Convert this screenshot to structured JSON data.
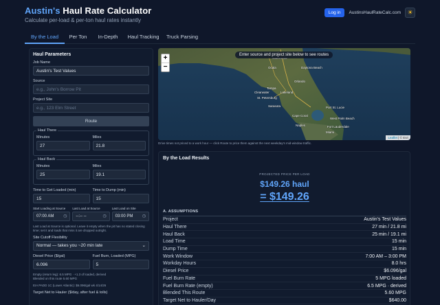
{
  "header": {
    "title_accent": "Austin's",
    "title_rest": " Haul Rate Calculator",
    "subtitle": "Calculate per-load & per-ton haul rates instantly",
    "login_label": "Log in",
    "site_link": "AustinsHaulRateCalc.com",
    "theme_icon": "sun-icon"
  },
  "tabs": [
    {
      "label": "By the Load",
      "active": true
    },
    {
      "label": "Per Ton"
    },
    {
      "label": "In-Depth"
    },
    {
      "label": "Haul Tracking"
    },
    {
      "label": "Truck Parsing"
    }
  ],
  "params": {
    "title": "Haul Parameters",
    "job_name_label": "Job Name",
    "job_name_value": "Austin's Test Values",
    "source_label": "Source",
    "source_placeholder": "e.g., John's Borrow Pit",
    "site_label": "Project Site",
    "site_placeholder": "e.g., 123 Elm Street",
    "route_label": "Route",
    "haul_there": {
      "legend": "Haul There",
      "minutes_label": "Minutes",
      "minutes": "27",
      "miles_label": "Miles",
      "miles": "21.8"
    },
    "haul_back": {
      "legend": "Haul Back",
      "minutes_label": "Minutes",
      "minutes": "25",
      "miles_label": "Miles",
      "miles": "19.1"
    },
    "load_label": "Time to Get Loaded (min)",
    "load_value": "15",
    "dump_label": "Time to Dump (min)",
    "dump_value": "15",
    "start_label": "Start Loading at Source",
    "start_value": "07:00 AM",
    "last_label": "Last Load at Source",
    "last_value": "--:-- --",
    "last_site_label": "Last Load on Site",
    "last_site_value": "03:00 PM",
    "time_note": "Last Load at Source is optional. Leave it empty when the pit has no stated closing time; set it and loads that miss it are dropped outright.",
    "cutoff_label": "Site Cutoff Flexibility",
    "cutoff_value": "Normal — takes you ~20 min late",
    "diesel_label": "Diesel Price ($/gal)",
    "diesel_value": "6.096",
    "burn_label": "Fuel Burn, Loaded (MPG)",
    "burn_value": "5",
    "empty_note": "Empty (return leg): 6.5 MPG · +1.3 of loaded, derived",
    "blended_note": "Blended on this route 5.60 MPG",
    "eia_note": "EIA PADD 1C (Lower Atlantic): $6.096/gal  wk 4/14/26",
    "target_label": "Target Net to Hauler ($/day, after fuel & tolls)"
  },
  "map": {
    "message": "Enter source and project site below to see routes",
    "zoom_in": "+",
    "zoom_out": "−",
    "attrib_leaflet": "Leaflet",
    "attrib_esri": "© Esri",
    "note": "Drive times not priced to a work hour — click Route to price them against the next weekday's mid-window traffic.",
    "places": [
      "Gainesville",
      "Ocala",
      "Daytona Beach",
      "Orlando",
      "Tampa",
      "Clearwater",
      "St. Petersburg",
      "Lakeland",
      "Sarasota",
      "Cape Coral",
      "Port St. Lucie",
      "West Palm Beach",
      "Fort Lauderdale",
      "Miami",
      "Naples"
    ]
  },
  "results": {
    "title": "By the Load Results",
    "projected_label": "PROJECTED PRICE PER LOAD",
    "haul_price": "$149.26 haul",
    "price": "= $149.26",
    "assumptions_header": "A. ASSUMPTIONS",
    "rows": [
      {
        "k": "Project",
        "v": "Austin's Test Values"
      },
      {
        "k": "Haul There",
        "v": "27 min / 21.8 mi"
      },
      {
        "k": "Haul Back",
        "v": "25 min / 19.1 mi"
      },
      {
        "k": "Load Time",
        "v": "15 min"
      },
      {
        "k": "Dump Time",
        "v": "15 min"
      },
      {
        "k": "Work Window",
        "v": "7:00 AM – 3:00 PM"
      },
      {
        "k": "Workday Hours",
        "v": "8.0 hrs"
      },
      {
        "k": "Diesel Price",
        "v": "$6.096/gal"
      },
      {
        "k": "Fuel Burn Rate",
        "v": "5 MPG loaded"
      },
      {
        "k": "Fuel Burn Rate (empty)",
        "v": "6.5 MPG · derived"
      },
      {
        "k": "Blended This Route",
        "v": "5.60 MPG"
      },
      {
        "k": "Target Net to Hauler/Day",
        "v": "$640.00"
      }
    ]
  }
}
